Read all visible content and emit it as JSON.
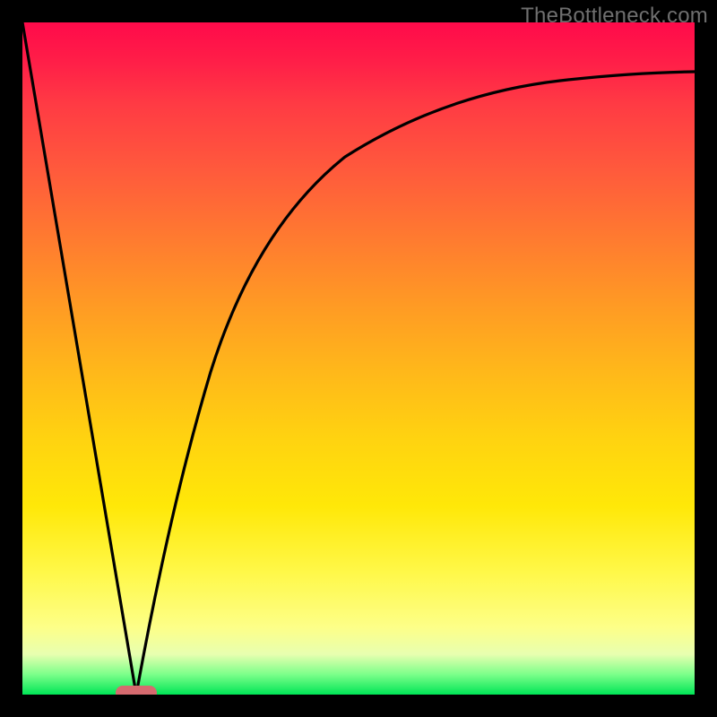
{
  "watermark": "TheBottleneck.com",
  "colors": {
    "frame": "#000000",
    "curve": "#000000",
    "pill": "#d66a6f",
    "watermark": "#6f6f6f"
  },
  "chart_data": {
    "type": "line",
    "title": "",
    "xlabel": "",
    "ylabel": "",
    "xlim": [
      0,
      100
    ],
    "ylim": [
      0,
      100
    ],
    "grid": false,
    "legend": false,
    "series": [
      {
        "name": "left-branch",
        "x": [
          0,
          5,
          10,
          14,
          17
        ],
        "values": [
          100,
          70,
          40,
          16,
          0
        ]
      },
      {
        "name": "right-branch",
        "x": [
          17,
          20,
          24,
          28,
          33,
          40,
          48,
          58,
          70,
          84,
          100
        ],
        "values": [
          0,
          18,
          38,
          52,
          63,
          72,
          79,
          84,
          88,
          90.5,
          92
        ]
      }
    ],
    "annotations": [
      {
        "name": "valley-pill",
        "x": 17,
        "y": 0,
        "shape": "pill",
        "fill": "#d66a6f"
      }
    ],
    "background_gradient": {
      "direction": "vertical",
      "stops": [
        {
          "pos": 0.0,
          "color": "#ff0a4a"
        },
        {
          "pos": 0.5,
          "color": "#ffb81a"
        },
        {
          "pos": 0.85,
          "color": "#fff84a"
        },
        {
          "pos": 1.0,
          "color": "#00e556"
        }
      ]
    }
  }
}
